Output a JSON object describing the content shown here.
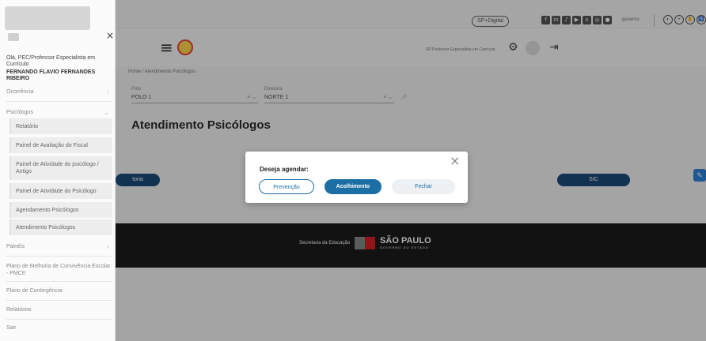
{
  "topbar": {
    "sp_digital": "SP+Digital",
    "social_icons": [
      "facebook-icon",
      "linkedin-icon",
      "tiktok-icon",
      "youtube-icon",
      "x-icon",
      "instagram-icon",
      "flickr-icon"
    ],
    "gov_text": "governo",
    "accessibility_icons": [
      "contrast-icon",
      "zoom-icon",
      "libras-icon",
      "accessibility-icon"
    ]
  },
  "header": {
    "user_text": "SP Professor Especialista em Currículo"
  },
  "breadcrumb": "Home / Atendimento Psicólogos",
  "filters": {
    "polo_label": "Polo",
    "polo_value": "POLO 1",
    "diretoria_label": "Diretoria",
    "diretoria_value": "NORTE 1"
  },
  "page_title": "Atendimento Psicólogos",
  "pills": {
    "left": "toria",
    "right": "SIC"
  },
  "footer": {
    "secretaria": "Secretaria da Educação",
    "sao_paulo": "SÃO PAULO",
    "governo": "GOVERNO DO ESTADO"
  },
  "sidebar": {
    "greeting": "Olá, PEC/Professor Especialista em Currículo",
    "user_name": "FERNANDO FLAVIO FERNANDES RIBEIRO",
    "items": {
      "ocorrencia": "Ocorrência",
      "psicologos": "Psicólogos",
      "paineis": "Painéis",
      "plano_melhoria": "Plano de Melhoria de Convivência Escolar - PMCE",
      "plano_contingencia": "Plano de Contingência",
      "relatorios": "Relatórios",
      "sair": "Sair"
    },
    "subitems": {
      "relatorio": "Relatório",
      "painel_fiscal": "Painel de Avaliação do Fiscal",
      "painel_antigo": "Painel de Atividade do psicólogo / Antigo",
      "painel_psicologo": "Painel de Atividade do Psicólogo",
      "agendamento": "Agendamento Psicólogos",
      "atendimento": "Atendimento Psicólogos"
    }
  },
  "modal": {
    "title": "Deseja agendar:",
    "buttons": {
      "prevencao": "Prevenção",
      "acolhimento": "Acolhimento",
      "fechar": "Fechar"
    }
  },
  "colors": {
    "primary": "#1c6fa4",
    "overlay": "rgba(0,0,0,0.32)",
    "footer": "#1b1b1b"
  }
}
